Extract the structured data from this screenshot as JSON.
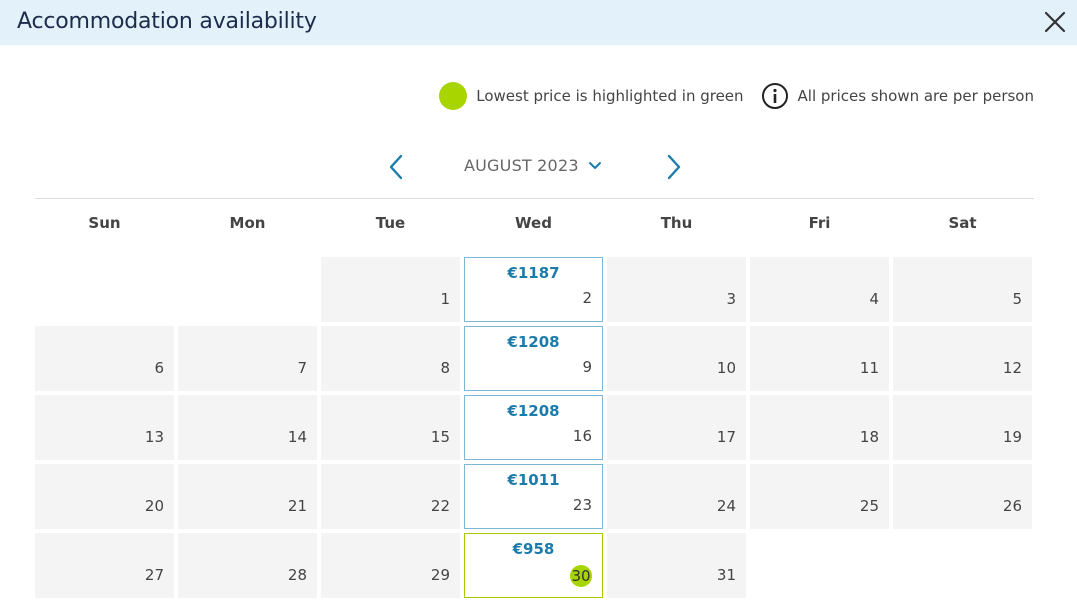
{
  "header": {
    "title": "Accommodation availability",
    "close_icon": "close-icon"
  },
  "legend": {
    "lowest_text": "Lowest price is highlighted in green",
    "lowest_color": "#a8d400",
    "info_text": "All prices shown are per person",
    "info_icon": "info-circle-icon"
  },
  "nav": {
    "month_label": "AUGUST 2023",
    "prev_icon": "chevron-left-icon",
    "next_icon": "chevron-right-icon",
    "dropdown_icon": "chevron-down-icon",
    "accent_color": "#1b7cab"
  },
  "weekdays": [
    "Sun",
    "Mon",
    "Tue",
    "Wed",
    "Thu",
    "Fri",
    "Sat"
  ],
  "calendar": {
    "weeks": [
      [
        null,
        null,
        {
          "day": "1"
        },
        {
          "day": "2",
          "price": "€1187"
        },
        {
          "day": "3"
        },
        {
          "day": "4"
        },
        {
          "day": "5"
        }
      ],
      [
        {
          "day": "6"
        },
        {
          "day": "7"
        },
        {
          "day": "8"
        },
        {
          "day": "9",
          "price": "€1208"
        },
        {
          "day": "10"
        },
        {
          "day": "11"
        },
        {
          "day": "12"
        }
      ],
      [
        {
          "day": "13"
        },
        {
          "day": "14"
        },
        {
          "day": "15"
        },
        {
          "day": "16",
          "price": "€1208"
        },
        {
          "day": "17"
        },
        {
          "day": "18"
        },
        {
          "day": "19"
        }
      ],
      [
        {
          "day": "20"
        },
        {
          "day": "21"
        },
        {
          "day": "22"
        },
        {
          "day": "23",
          "price": "€1011"
        },
        {
          "day": "24"
        },
        {
          "day": "25"
        },
        {
          "day": "26"
        }
      ],
      [
        {
          "day": "27"
        },
        {
          "day": "28"
        },
        {
          "day": "29"
        },
        {
          "day": "30",
          "price": "€958",
          "lowest": true
        },
        {
          "day": "31"
        },
        null,
        null
      ]
    ]
  }
}
